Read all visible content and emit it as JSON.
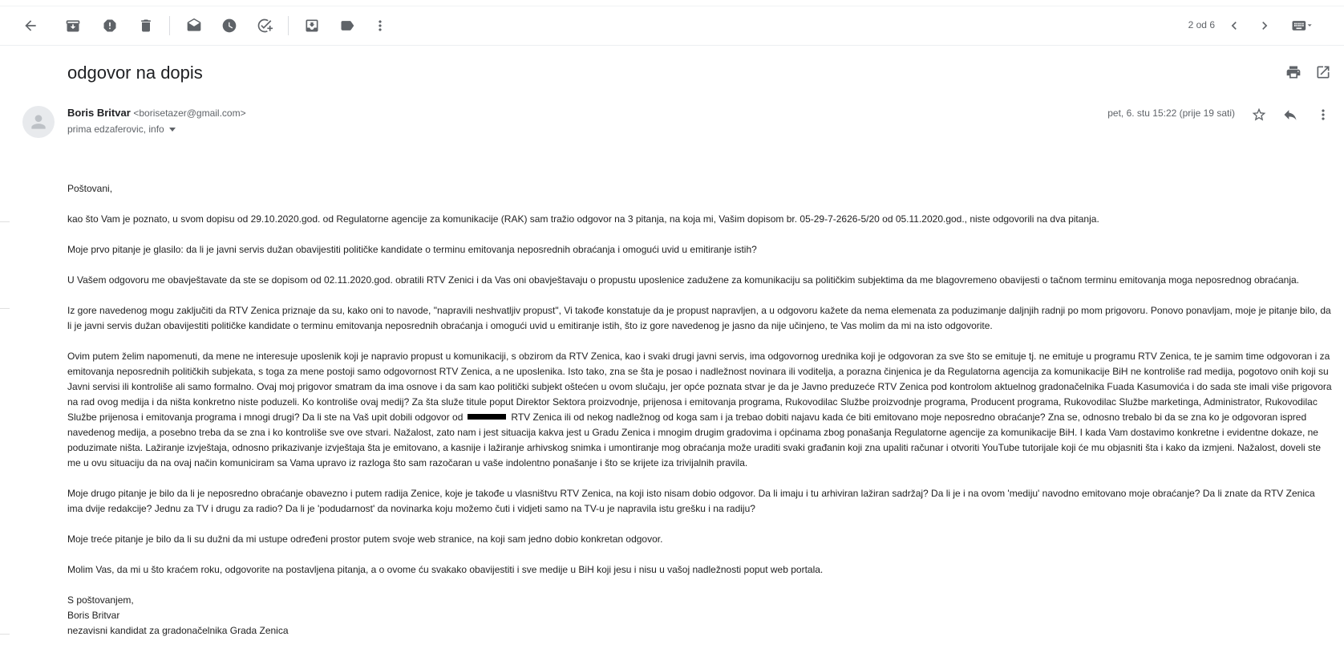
{
  "toolbar": {
    "icons": [
      "back-arrow-icon",
      "archive-icon",
      "report-spam-icon",
      "delete-icon",
      "mark-unread-icon",
      "snooze-icon",
      "add-task-icon",
      "move-to-icon",
      "label-icon",
      "more-vert-icon"
    ],
    "pager_text": "2 od 6",
    "input_tools": "keyboard-icon"
  },
  "email": {
    "subject": "odgovor na dopis",
    "sender_name": "Boris Britvar",
    "sender_email": "<borisetazer@gmail.com>",
    "recipients": "prima edzaferovic, info",
    "date": "pet, 6. stu 15:22 (prije 19 sati)"
  },
  "body": {
    "greeting": "Poštovani,",
    "p1": "kao što Vam je poznato, u svom dopisu od 29.10.2020.god. od Regulatorne agencije za komunikacije (RAK) sam tražio odgovor na 3 pitanja, na koja mi, Vašim dopisom br. 05-29-7-2626-5/20 od 05.11.2020.god., niste odgovorili na dva pitanja.",
    "p2": "Moje prvo pitanje je glasilo: da li je javni servis dužan obavijestiti političke kandidate o terminu emitovanja neposrednih obraćanja i omogući uvid u emitiranje istih?",
    "p3": "U Vašem odgovoru me obavještavate da ste se dopisom od 02.11.2020.god. obratili RTV Zenici i da Vas oni obavještavaju o propustu uposlenice zadužene za komunikaciju sa političkim subjektima da me blagovremeno obavijesti o tačnom terminu emitovanja moga neposrednog obraćanja.",
    "p4": "Iz gore navedenog mogu zaključiti da RTV Zenica priznaje da su, kako oni to navode, \"napravili neshvatljiv propust\", Vi takođe konstatuje da je propust napravljen, a u odgovoru kažete da nema elemenata za poduzimanje daljnjih radnji po mom prigovoru. Ponovo ponavljam, moje je pitanje bilo, da li je javni servis dužan obavijestiti političke kandidate o terminu emitovanja neposrednih obraćanja i omogući uvid u emitiranje istih, što iz gore navedenog je jasno da nije učinjeno, te Vas molim da mi na isto odgovorite.",
    "p5a": "Ovim putem želim napomenuti, da mene ne interesuje uposlenik koji je napravio propust u komunikaciji, s obzirom da RTV Zenica, kao i svaki drugi javni servis, ima odgovornog urednika koji je odgovoran za sve što se emituje tj. ne emituje u programu RTV Zenica, te je samim time odgovoran i za emitovanja neposrednih političkih subjekata, s toga za mene postoji samo odgovornost RTV Zenica, a ne uposlenika. Isto tako, zna se šta je posao i nadležnost novinara ili voditelja, a porazna činjenica je da Regulatorna agencija za komunikacije BiH ne kontroliše rad medija, pogotovo onih koji su Javni servisi ili kontroliše ali samo formalno. Ovaj moj prigovor smatram da ima osnove i da sam kao politički subjekt oštećen u ovom slučaju, jer opće poznata stvar je da je Javno preduzeće RTV Zenica pod kontrolom aktuelnog gradonačelnika Fuada Kasumovića i do sada ste imali više prigovora na rad ovog medija i da ništa konkretno niste poduzeli. Ko kontroliše ovaj medij? Za šta služe titule poput Direktor Sektora proizvodnje, prijenosa i emitovanja programa, Rukovodilac Službe proizvodnje programa, Producent programa, Rukovodilac Službe marketinga, Administrator, Rukovodilac Službe prijenosa i emitovanja programa i mnogi drugi? Da li ste na Vaš upit dobili odgovor od",
    "p5b": "RTV Zenica ili od nekog nadležnog od koga sam i ja trebao dobiti najavu kada će biti emitovano moje neposredno obraćanje? Zna se, odnosno trebalo bi da se zna ko je odgovoran ispred navedenog medija, a posebno treba da se zna i ko kontroliše sve ove stvari. Nažalost, zato nam i jest situacija kakva jest u Gradu Zenica i mnogim drugim gradovima i općinama zbog ponašanja Regulatorne agencije za komunikacije BiH. I kada Vam dostavimo konkretne i evidentne dokaze, ne poduzimate ništa. Lažiranje izvještaja, odnosno prikazivanje izvještaja šta je emitovano, a kasnije i lažiranje arhivskog snimka i umontiranje mog obraćanja može uraditi svaki građanin koji zna upaliti računar i otvoriti YouTube tutorijale koji će mu objasniti šta i kako da izmjeni. Nažalost, doveli ste me u ovu situaciju da na ovaj način komuniciram sa Vama upravo iz razloga što sam razočaran u vaše indolentno ponašanje i što se krijete iza trivijalnih pravila.",
    "p6": "Moje drugo pitanje je bilo da li je neposredno obraćanje obavezno i putem radija Zenice, koje je takođe u vlasništvu RTV Zenica, na koji isto nisam dobio odgovor. Da li imaju i tu arhiviran lažiran sadržaj? Da li je i na ovom 'mediju' navodno emitovano moje obraćanje? Da li znate da RTV Zenica ima dvije redakcije? Jednu za TV i drugu za radio? Da li je 'podudarnost' da novinarka koju možemo čuti i vidjeti samo na TV-u je napravila istu grešku i na radiju?",
    "p7": "Moje treće pitanje je bilo da li su dužni da mi ustupe određeni prostor putem svoje web stranice, na koji sam jedno dobio konkretan odgovor.",
    "p8": "Molim Vas, da mi u što kraćem roku, odgovorite na postavljena pitanja, a o ovome ću svakako obavijestiti i sve medije u BiH koji jesu i nisu u vašoj nadležnosti poput web portala.",
    "sig1": "S poštovanjem,",
    "sig2": "Boris Britvar",
    "sig3": "nezavisni kandidat za gradonačelnika Grada Zenica"
  }
}
